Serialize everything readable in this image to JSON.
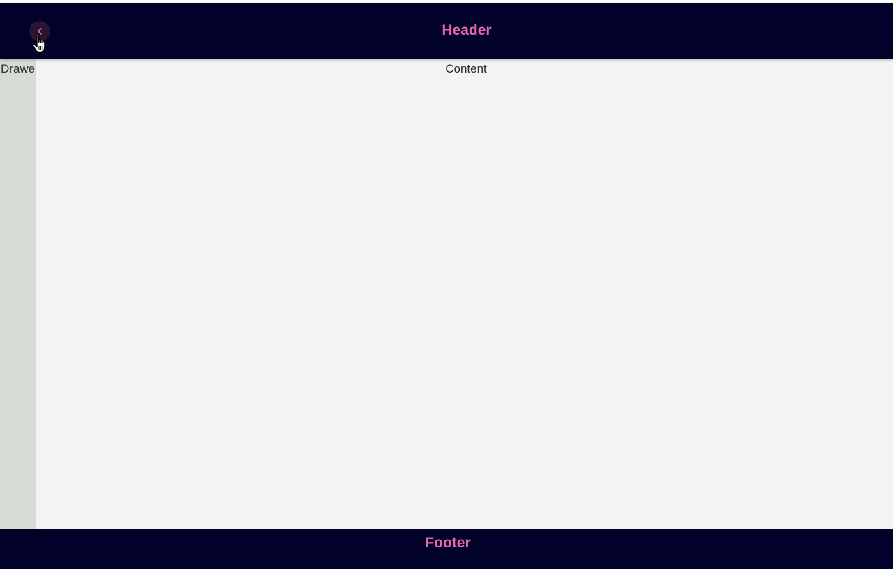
{
  "header": {
    "title": "Header",
    "collapse_icon": "chevron-left-icon"
  },
  "drawer": {
    "label": "Drawer"
  },
  "content": {
    "label": "Content"
  },
  "footer": {
    "title": "Footer"
  },
  "colors": {
    "bar_background": "#02012a",
    "accent_text": "#e668a8",
    "drawer_background": "#d7dbd6",
    "content_background": "#f4f3f3"
  }
}
